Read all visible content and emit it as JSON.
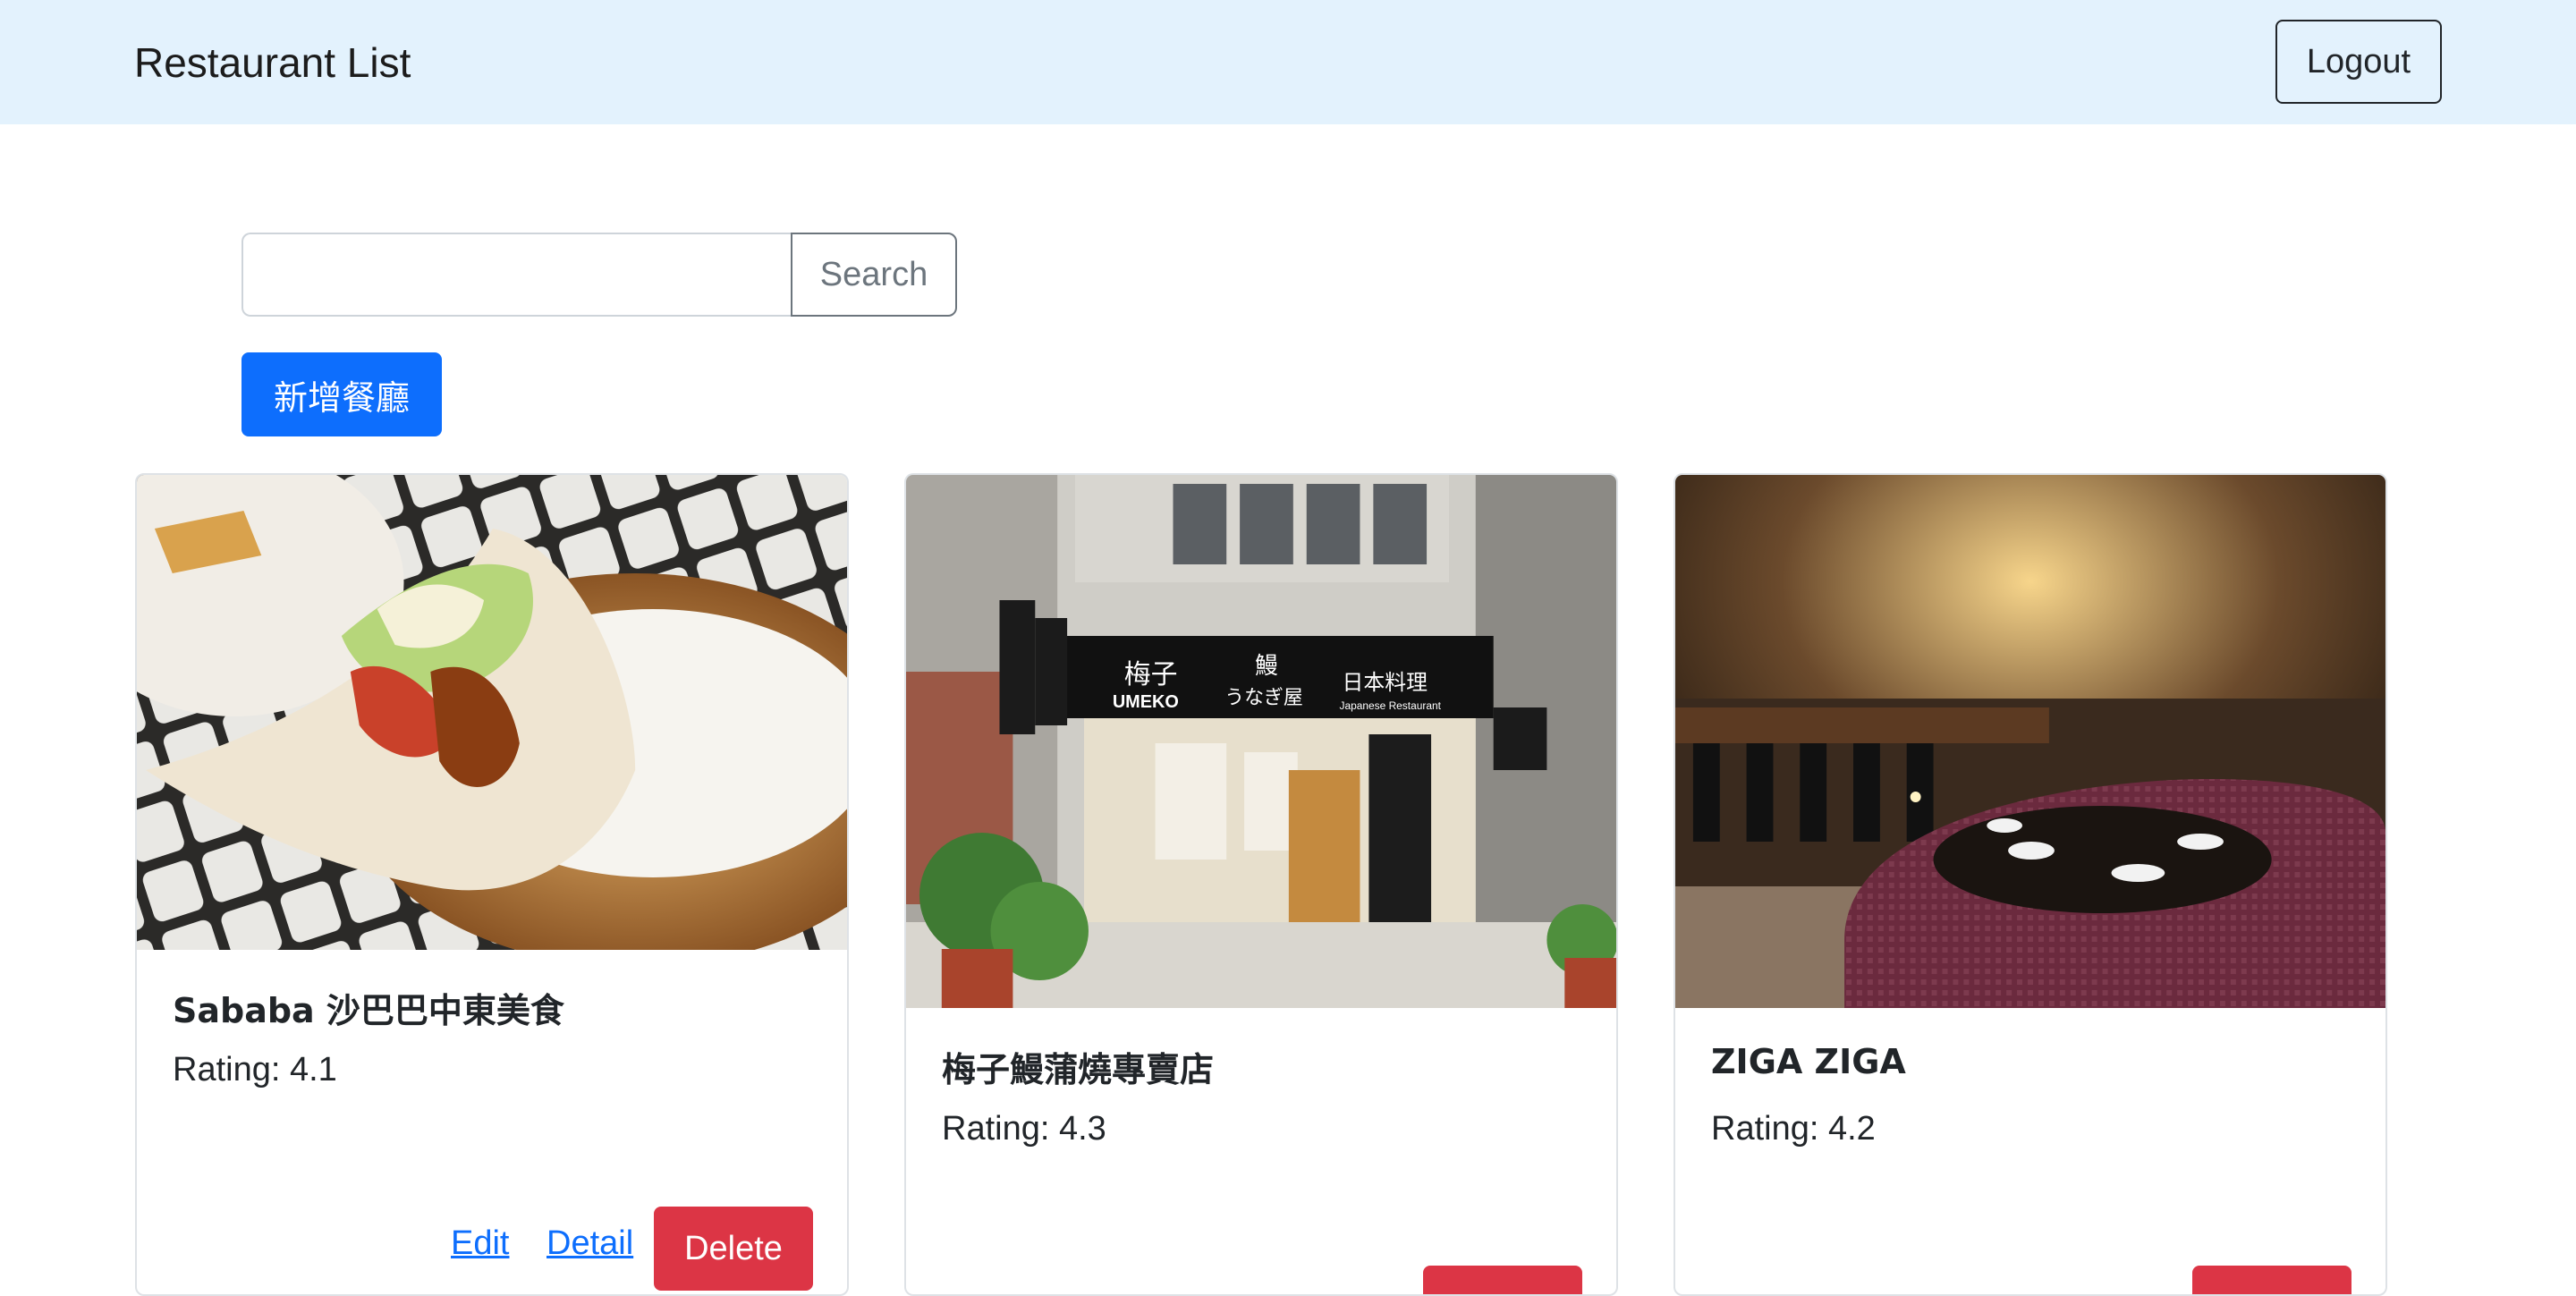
{
  "navbar": {
    "brand": "Restaurant List",
    "logout_label": "Logout"
  },
  "search": {
    "value": "",
    "placeholder": "",
    "button_label": "Search"
  },
  "add_button_label": "新增餐廳",
  "restaurants": [
    {
      "name": "Sababa 沙巴巴中東美食",
      "rating": "Rating: 4.1",
      "edit_label": "Edit",
      "detail_label": "Detail",
      "delete_label": "Delete"
    },
    {
      "name": "梅子鰻蒲燒專賣店",
      "rating": "Rating: 4.3",
      "delete_label": ""
    },
    {
      "name": "ZIGA ZIGA",
      "rating": "Rating: 4.2",
      "delete_label": ""
    }
  ],
  "shop_sign": {
    "name": "梅子",
    "romaji": "UMEKO",
    "unagi": "鰻",
    "unagiya": "うなぎ屋",
    "cuisine": "日本料理",
    "cuisine_en": "Japanese Restaurant"
  }
}
